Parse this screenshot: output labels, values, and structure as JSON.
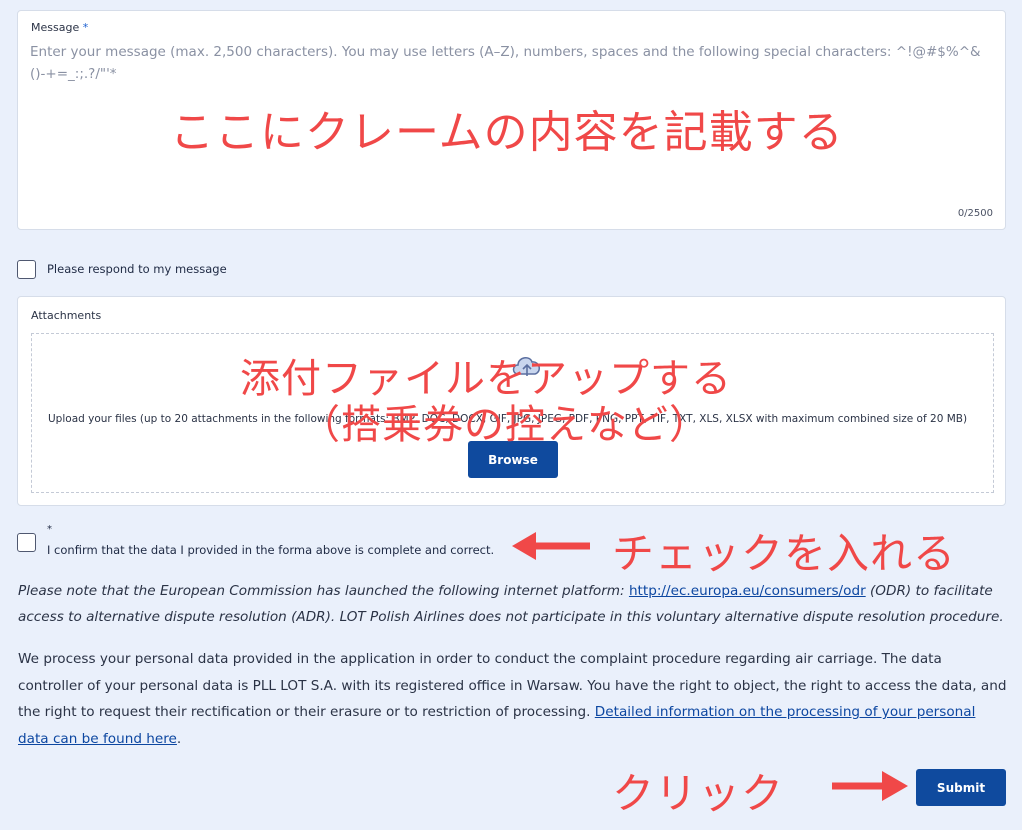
{
  "message": {
    "label": "Message",
    "required_mark": "*",
    "placeholder": "Enter your message (max. 2,500 characters). You may use letters (A–Z), numbers, spaces and the following special characters: ^!@#$%^&()-+=_:;.?/\"'*",
    "value": "",
    "counter": "0/2500"
  },
  "respond_checkbox": {
    "label": "Please respond to my message",
    "checked": false
  },
  "attachments": {
    "label": "Attachments",
    "upload_text": "Upload your files (up to 20 attachments in the following formats: BMP, DOC, DOCX, GIF, JPG, JPEG, PDF, PNG, PPT, TIF, TXT, XLS, XLSX with maximum combined size of 20 MB)",
    "browse_label": "Browse"
  },
  "confirm_checkbox": {
    "required_mark": "*",
    "label": "I confirm that the data I provided in the forma above is complete and correct.",
    "checked": false
  },
  "note": {
    "before": "Please note that the European Commission has launched the following internet platform: ",
    "link": "http://ec.europa.eu/consumers/odr",
    "after": " (ODR) to facilitate access to alternative dispute resolution (ADR). LOT Polish Airlines does not participate in this voluntary alternative dispute resolution procedure."
  },
  "privacy": {
    "text": "We process your personal data provided in the application in order to conduct the complaint procedure regarding air carriage. The data controller of your personal data is PLL LOT S.A. with its registered office in Warsaw. You have the right to object, the right to access the data, and the right to request their rectification or their erasure or to restriction of processing. ",
    "link": "Detailed information on the processing of your personal data can be found here",
    "end": "."
  },
  "submit_label": "Submit",
  "annotations": {
    "message": "ここにクレームの内容を記載する",
    "attach_line1": "添付ファイルをアップする",
    "attach_line2": "（搭乗券の控えなど）",
    "checkbox": "チェックを入れる",
    "click": "クリック"
  },
  "colors": {
    "background": "#eaf0fb",
    "button": "#0f4a9e",
    "link": "#0d47a1",
    "annotation": "#f04848"
  }
}
